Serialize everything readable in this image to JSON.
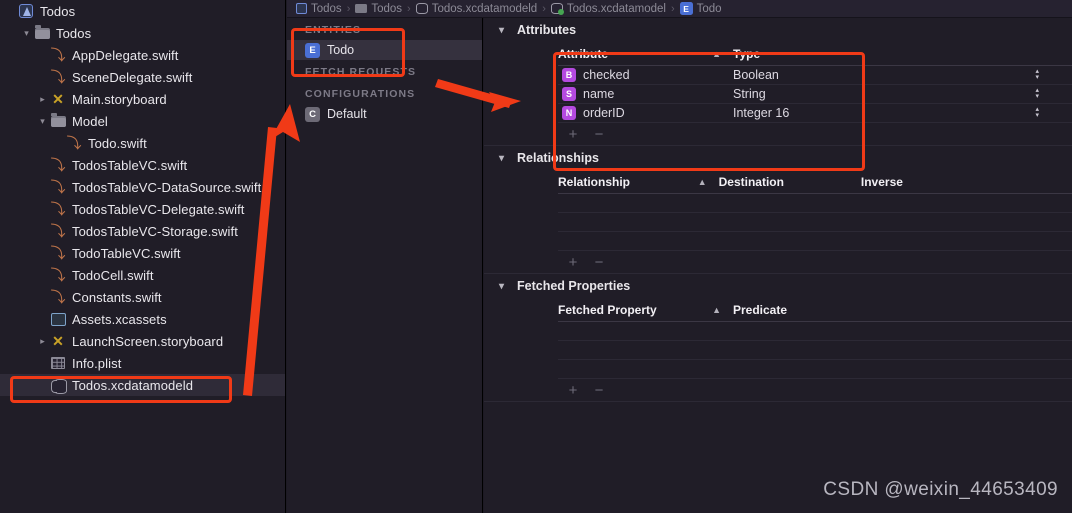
{
  "navigator": {
    "rows": [
      {
        "label": "Todos",
        "icon": "app-icon",
        "indent": 0,
        "disclosure": "",
        "selected": false
      },
      {
        "label": "Todos",
        "icon": "folder-icon",
        "indent": 1,
        "disclosure": "v",
        "selected": false
      },
      {
        "label": "AppDelegate.swift",
        "icon": "swift-icon",
        "indent": 2,
        "disclosure": "",
        "selected": false
      },
      {
        "label": "SceneDelegate.swift",
        "icon": "swift-icon",
        "indent": 2,
        "disclosure": "",
        "selected": false
      },
      {
        "label": "Main.storyboard",
        "icon": "storyboard-icon",
        "indent": 2,
        "disclosure": ">",
        "selected": false
      },
      {
        "label": "Model",
        "icon": "folder-icon",
        "indent": 2,
        "disclosure": "v",
        "selected": false
      },
      {
        "label": "Todo.swift",
        "icon": "swift-icon",
        "indent": 3,
        "disclosure": "",
        "selected": false
      },
      {
        "label": "TodosTableVC.swift",
        "icon": "swift-icon",
        "indent": 2,
        "disclosure": "",
        "selected": false
      },
      {
        "label": "TodosTableVC-DataSource.swift",
        "icon": "swift-icon",
        "indent": 2,
        "disclosure": "",
        "selected": false
      },
      {
        "label": "TodosTableVC-Delegate.swift",
        "icon": "swift-icon",
        "indent": 2,
        "disclosure": "",
        "selected": false
      },
      {
        "label": "TodosTableVC-Storage.swift",
        "icon": "swift-icon",
        "indent": 2,
        "disclosure": "",
        "selected": false
      },
      {
        "label": "TodoTableVC.swift",
        "icon": "swift-icon",
        "indent": 2,
        "disclosure": "",
        "selected": false
      },
      {
        "label": "TodoCell.swift",
        "icon": "swift-icon",
        "indent": 2,
        "disclosure": "",
        "selected": false
      },
      {
        "label": "Constants.swift",
        "icon": "swift-icon",
        "indent": 2,
        "disclosure": "",
        "selected": false
      },
      {
        "label": "Assets.xcassets",
        "icon": "assets-icon",
        "indent": 2,
        "disclosure": "",
        "selected": false
      },
      {
        "label": "LaunchScreen.storyboard",
        "icon": "storyboard-icon",
        "indent": 2,
        "disclosure": ">",
        "selected": false
      },
      {
        "label": "Info.plist",
        "icon": "plist-icon",
        "indent": 2,
        "disclosure": "",
        "selected": false
      },
      {
        "label": "Todos.xcdatamodeld",
        "icon": "xcdatamodeld-icon",
        "indent": 2,
        "disclosure": "",
        "selected": true
      }
    ]
  },
  "breadcrumb": {
    "items": [
      {
        "label": "Todos",
        "icon": "app-icon"
      },
      {
        "label": "Todos",
        "icon": "folder-icon"
      },
      {
        "label": "Todos.xcdatamodeld",
        "icon": "xcdatamodeld-icon"
      },
      {
        "label": "Todos.xcdatamodel",
        "icon": "datamodel-version-icon"
      },
      {
        "label": "Todo",
        "icon": "entity-icon",
        "badge": "E"
      }
    ],
    "separator": "›"
  },
  "outline": {
    "sections": [
      {
        "title": "ENTITIES",
        "rows": [
          {
            "badge": "E",
            "badge_color": "#4a6fd4",
            "label": "Todo",
            "selected": true
          }
        ]
      },
      {
        "title": "FETCH REQUESTS",
        "rows": []
      },
      {
        "title": "CONFIGURATIONS",
        "rows": [
          {
            "badge": "C",
            "badge_color": "#6d6a76",
            "label": "Default",
            "selected": false
          }
        ]
      }
    ]
  },
  "editor": {
    "groups": [
      {
        "title": "Attributes",
        "collapsed": false,
        "columns": [
          "Attribute",
          "Type"
        ],
        "sort_column": 0,
        "rows": [
          {
            "badge": "B",
            "badge_color": "#b44ae0",
            "name": "checked",
            "type": "Boolean"
          },
          {
            "badge": "S",
            "badge_color": "#b44ae0",
            "name": "name",
            "type": "String"
          },
          {
            "badge": "N",
            "badge_color": "#b44ae0",
            "name": "orderID",
            "type": "Integer 16"
          }
        ],
        "empty_rows": 0,
        "add_label": "+",
        "remove_label": "−"
      },
      {
        "title": "Relationships",
        "collapsed": false,
        "columns": [
          "Relationship",
          "Destination",
          "Inverse"
        ],
        "sort_column": 0,
        "rows": [],
        "empty_rows": 3,
        "add_label": "+",
        "remove_label": "−"
      },
      {
        "title": "Fetched Properties",
        "collapsed": false,
        "columns": [
          "Fetched Property",
          "Predicate"
        ],
        "sort_column": 0,
        "rows": [],
        "empty_rows": 3,
        "add_label": "+",
        "remove_label": "−"
      }
    ]
  },
  "watermark": {
    "text": "CSDN @weixin_44653409"
  },
  "colors": {
    "accent_highlight": "#f03a17",
    "entity_badge": "#4a6fd4",
    "attribute_badge": "#b44ae0",
    "config_badge": "#6d6a76",
    "background": "#201d27",
    "selection": "#35313e"
  }
}
